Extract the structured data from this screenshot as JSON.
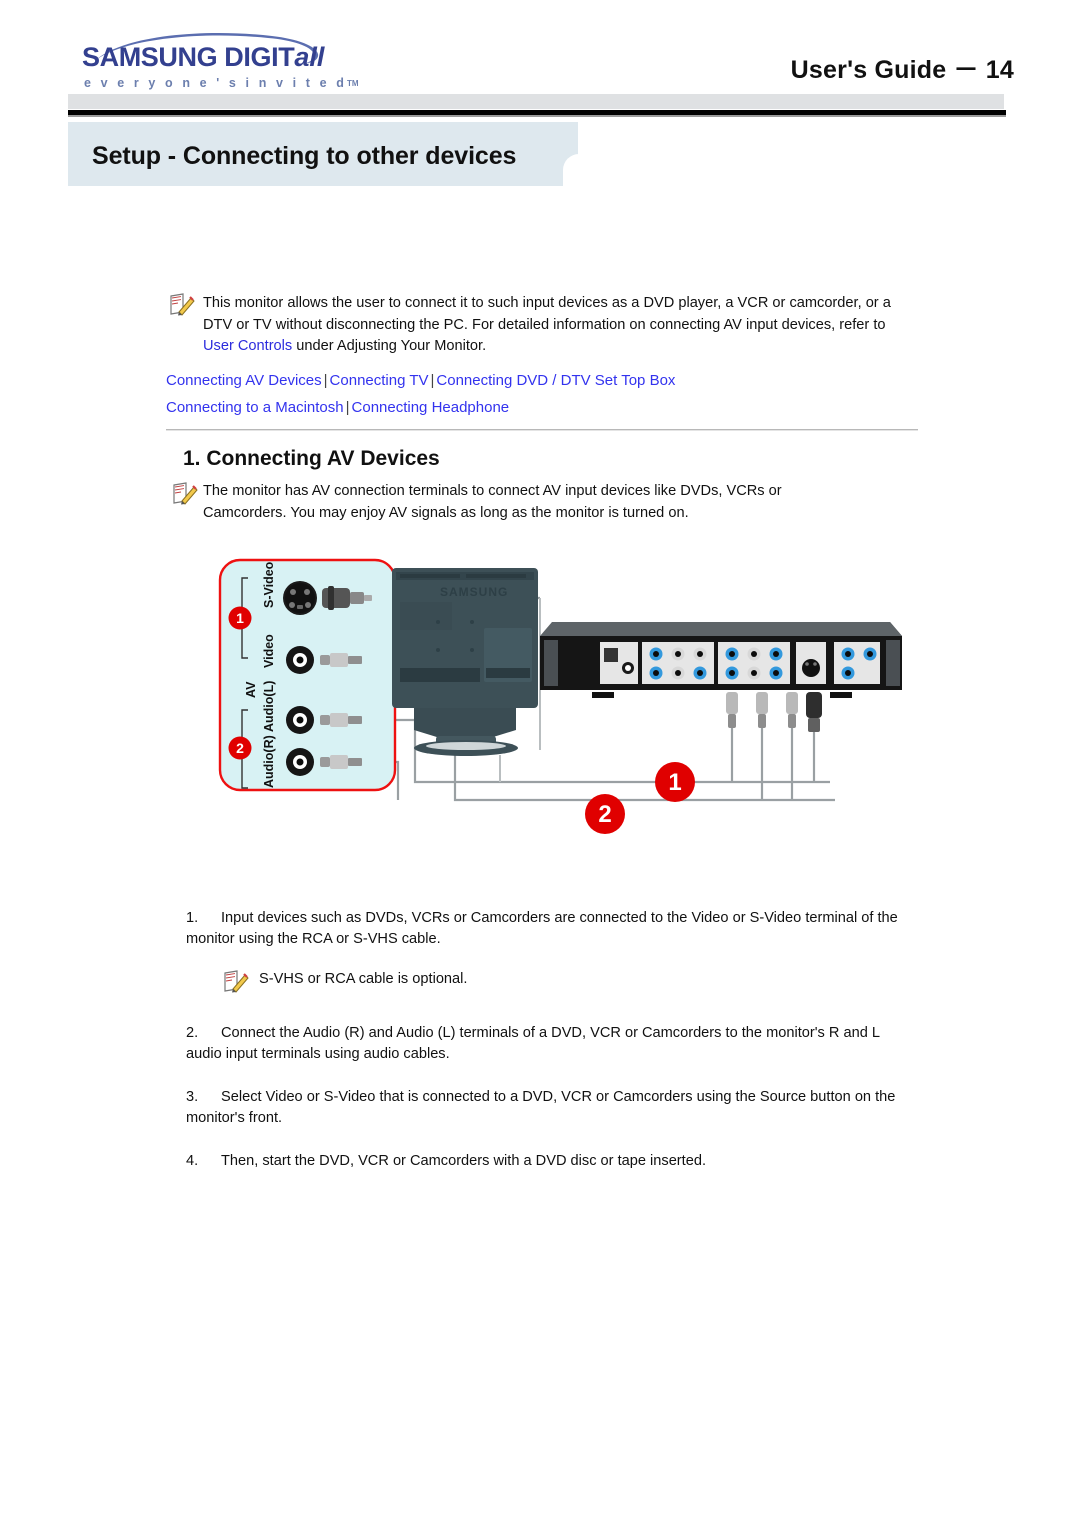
{
  "header": {
    "logo_brand": "SAMSUNG DIGIT",
    "logo_brand_italic": "all",
    "logo_tagline": "e v e r y o n e ' s   i n v i t e d",
    "logo_tagline_tm": "TM",
    "guide_label": "User's Guide － 14"
  },
  "title_banner": {
    "title": "Setup - Connecting to other devices",
    "background_color": "#dee8ee"
  },
  "intro": {
    "icon": "note-pencil-icon",
    "text_part1": "This monitor allows the user to connect it to such input devices as a DVD player, a VCR or camcorder, or a DTV or TV without disconnecting the PC. For detailed information on connecting AV input devices, refer to ",
    "link_text": "User Controls",
    "text_part2": " under Adjusting Your Monitor."
  },
  "nav": {
    "links": [
      "Connecting AV Devices",
      "Connecting TV",
      "Connecting  DVD / DTV Set Top Box",
      "Connecting to a Macintosh",
      "Connecting Headphone"
    ],
    "separator": "|",
    "link_color": "#3333ee"
  },
  "section": {
    "heading": "1. Connecting AV Devices",
    "icon": "note-pencil-icon",
    "text": "The monitor has AV connection terminals to connect AV input devices like DVDs, VCRs or Camcorders. You may enjoy AV signals as long as the monitor is turned on."
  },
  "diagram": {
    "callout_border_color": "#ee1111",
    "callout_fill_color": "#d8f2f4",
    "badge_color": "#e00000",
    "panel_labels": [
      "S-Video",
      "Video",
      "AV",
      "Audio(L)",
      "Audio(R)"
    ],
    "callout_badges": [
      "1",
      "2"
    ],
    "cable_badges": [
      "1",
      "2"
    ],
    "monitor_brand": "SAMSUNG"
  },
  "steps": [
    {
      "number": "1.",
      "text": "Input devices such as DVDs, VCRs or Camcorders are connected to the Video or S-Video terminal of the monitor using the RCA or S-VHS cable."
    },
    {
      "number": "2.",
      "text": "Connect the Audio (R) and Audio (L) terminals of a DVD, VCR or Camcorders to the monitor's R and L audio input terminals using audio cables."
    },
    {
      "number": "3.",
      "text": "Select Video or S-Video that is connected to a DVD, VCR or Camcorders using the Source button on the monitor's front."
    },
    {
      "number": "4.",
      "text": "Then, start the DVD, VCR or Camcorders with a DVD disc or tape inserted."
    }
  ],
  "sub_note": {
    "icon": "note-pencil-icon",
    "text": "S-VHS or RCA cable is optional."
  }
}
